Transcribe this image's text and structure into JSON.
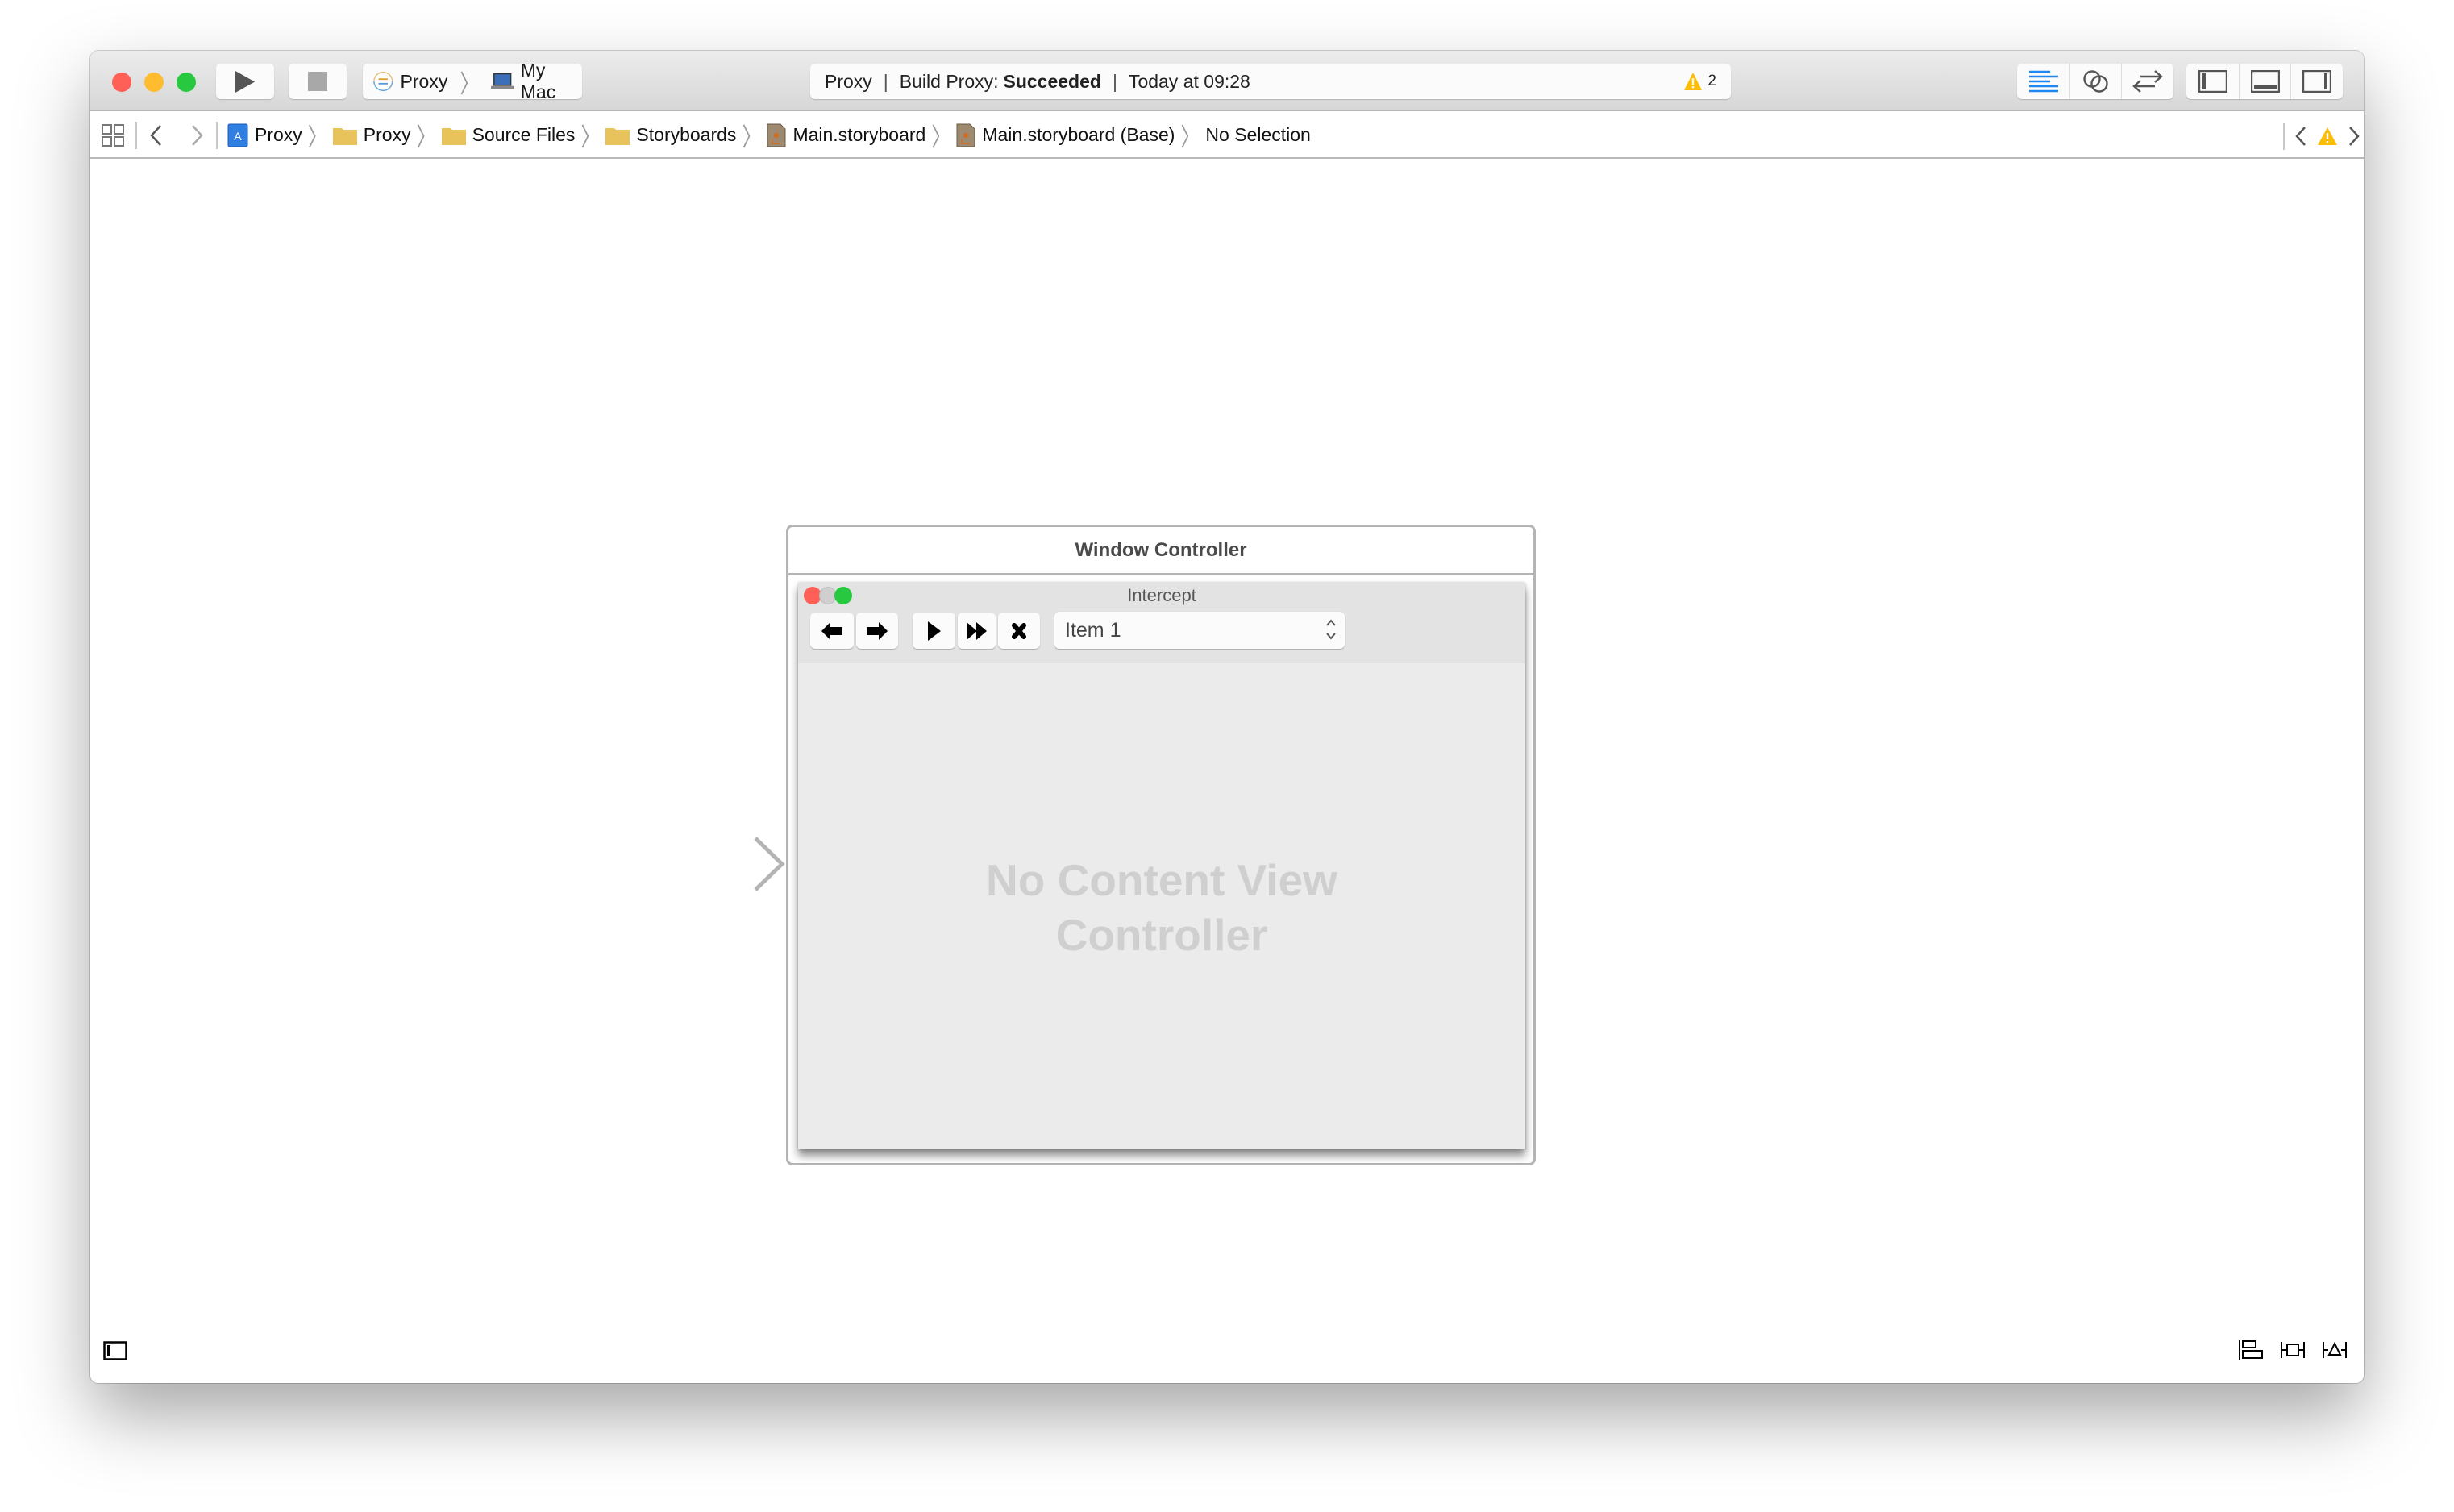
{
  "titlebar": {
    "traffic_lights": {
      "close": "#fe5f57",
      "minimize": "#febc2e",
      "zoom": "#28c840"
    },
    "run_button_icon": "play-icon",
    "stop_button_icon": "stop-icon",
    "scheme": {
      "target": "Proxy",
      "destination": "My Mac"
    },
    "activity": {
      "project": "Proxy",
      "status_prefix": "Build Proxy:",
      "status_result": "Succeeded",
      "timestamp": "Today at 09:28",
      "warning_count": "2"
    },
    "editor_modes": [
      "standard-editor-icon",
      "assistant-editor-icon",
      "version-editor-icon"
    ],
    "active_editor_mode": "standard-editor-icon",
    "view_toggles": [
      "navigator-toggle-icon",
      "debug-area-toggle-icon",
      "utilities-toggle-icon"
    ],
    "accent_color": "#1e88f5"
  },
  "jumpbar": {
    "breadcrumbs": [
      {
        "label": "Proxy",
        "icon": "project-icon"
      },
      {
        "label": "Proxy",
        "icon": "folder-icon"
      },
      {
        "label": "Source Files",
        "icon": "folder-icon"
      },
      {
        "label": "Storyboards",
        "icon": "folder-icon"
      },
      {
        "label": "Main.storyboard",
        "icon": "storyboard-file-icon"
      },
      {
        "label": "Main.storyboard (Base)",
        "icon": "storyboard-file-icon"
      },
      {
        "label": "No Selection",
        "icon": null
      }
    ],
    "folder_color": "#e8c25a",
    "warning_color": "#fbbd08"
  },
  "canvas": {
    "scene": {
      "title": "Window Controller",
      "window": {
        "title": "Intercept",
        "toolbar_buttons": [
          {
            "name": "back",
            "icon": "arrow-left-icon"
          },
          {
            "name": "forward",
            "icon": "arrow-right-icon"
          },
          {
            "name": "play",
            "icon": "play-icon"
          },
          {
            "name": "fast-forward",
            "icon": "fast-forward-icon"
          },
          {
            "name": "stop",
            "icon": "x-icon"
          }
        ],
        "popup_value": "Item 1",
        "placeholder_line1": "No Content View",
        "placeholder_line2": "Controller"
      }
    }
  },
  "bottom_bar": {
    "left_icon": "document-outline-toggle-icon",
    "right_icons": [
      "stack-icon",
      "align-icon",
      "resolve-autolayout-icon"
    ]
  }
}
